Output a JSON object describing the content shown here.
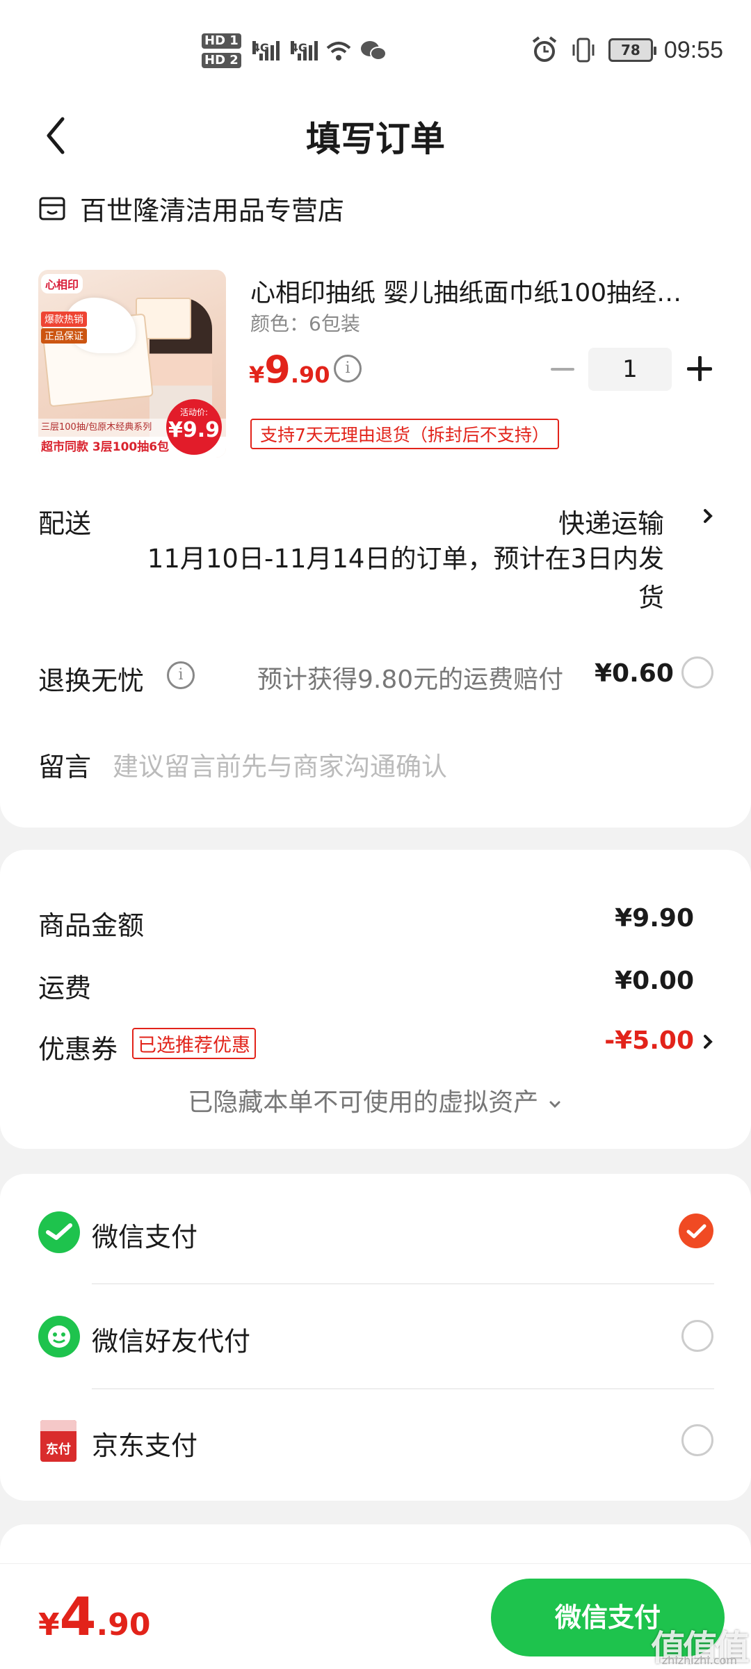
{
  "status_bar": {
    "hd1": "HD 1",
    "hd2": "HD 2",
    "net1": "4G",
    "net2": "4G",
    "battery": "78",
    "time": "09:55"
  },
  "header": {
    "title": "填写订单"
  },
  "shop": {
    "name": "百世隆清洁用品专营店"
  },
  "product": {
    "title": "心相印抽纸 婴儿抽纸面巾纸100抽经…",
    "spec": "颜色：6包装",
    "price_symbol": "¥",
    "price_int": "9",
    "price_dec": ".90",
    "quantity": "1",
    "return_policy": "支持7天无理由退货（拆封后不支持）",
    "image": {
      "logo": "心相印",
      "tag1": "爆款热销",
      "tag2": "正品保证",
      "band_mid": "三层100抽/包原木经典系列",
      "band_bottom": "超市同款 3层100抽6包",
      "price_small": "活动价:",
      "price_big": "¥9.9"
    }
  },
  "delivery": {
    "label": "配送",
    "method": "快递运输",
    "note": "11月10日-11月14日的订单，预计在3日内发货"
  },
  "worry_free": {
    "label": "退换无忧",
    "description": "预计获得9.80元的运费赔付",
    "price": "¥0.60"
  },
  "message": {
    "label": "留言",
    "placeholder": "建议留言前先与商家沟通确认"
  },
  "summary": {
    "goods_label": "商品金额",
    "goods_value": "¥9.90",
    "shipping_label": "运费",
    "shipping_value": "¥0.00",
    "coupon_label": "优惠券",
    "coupon_tag": "已选推荐优惠",
    "coupon_value": "-¥5.00",
    "hidden_assets": "已隐藏本单不可使用的虚拟资产"
  },
  "payment": {
    "options": [
      {
        "label": "微信支付",
        "icon": "wechat-pay-icon",
        "selected": true
      },
      {
        "label": "微信好友代付",
        "icon": "wechat-friend-pay-icon",
        "selected": false
      },
      {
        "label": "京东支付",
        "icon": "jd-pay-icon",
        "selected": false
      }
    ],
    "jd_icon_text": "东付"
  },
  "footer": {
    "total_symbol": "¥",
    "total_int": "4",
    "total_dec": ".90",
    "pay_button": "微信支付",
    "watermark": "值值值",
    "watermark_sub": "zhizhizhi.com"
  },
  "colors": {
    "accent_red": "#e2231a",
    "wechat_green": "#1ec34d",
    "check_orange": "#f04a23"
  }
}
